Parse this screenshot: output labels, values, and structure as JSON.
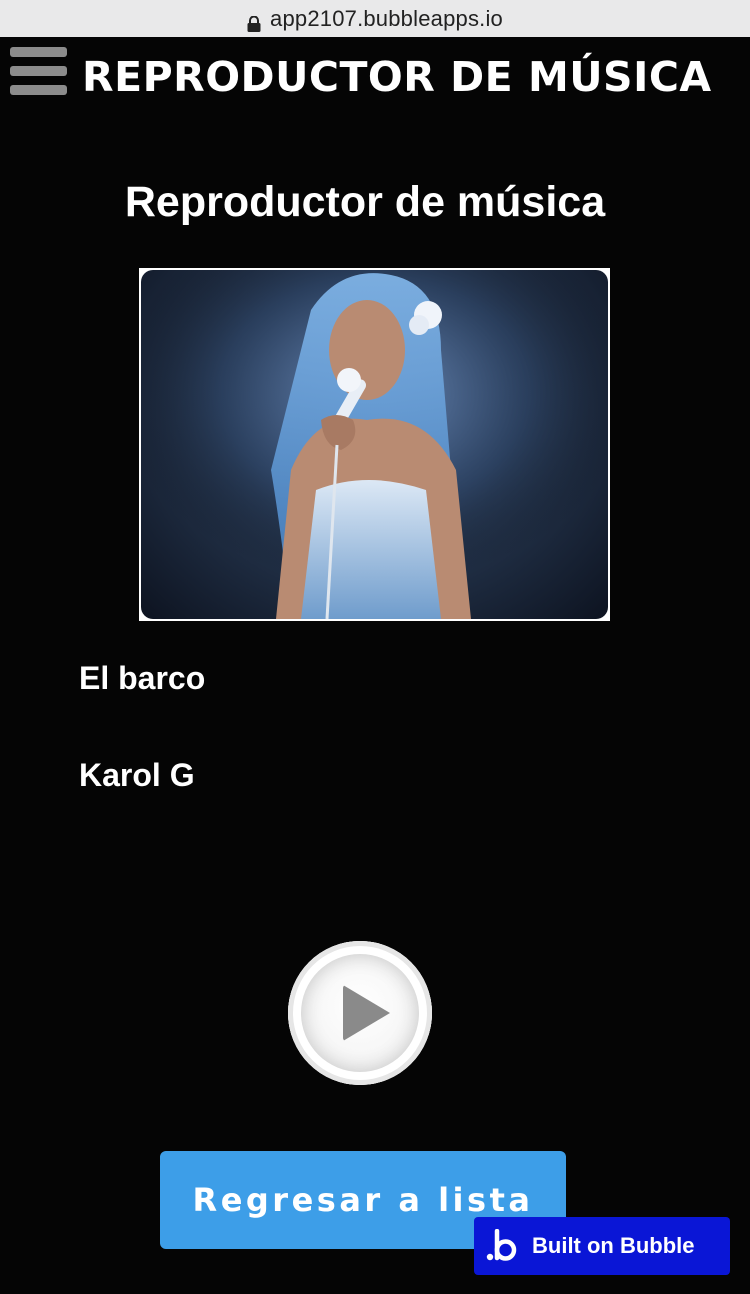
{
  "browser": {
    "url": "app2107.bubbleapps.io"
  },
  "header": {
    "title": "REPRODUCTOR DE MÚSICA"
  },
  "main": {
    "heading": "Reproductor de música",
    "song_title": "El barco",
    "artist": "Karol G",
    "back_button_label": "Regresar a lista"
  },
  "badge": {
    "label": "Built on Bubble"
  },
  "colors": {
    "background": "#050505",
    "button": "#3d9ee8",
    "badge": "#0a16d6"
  },
  "icons": [
    "lock-icon",
    "hamburger-menu-icon",
    "play-icon",
    "bubble-logo-icon"
  ]
}
